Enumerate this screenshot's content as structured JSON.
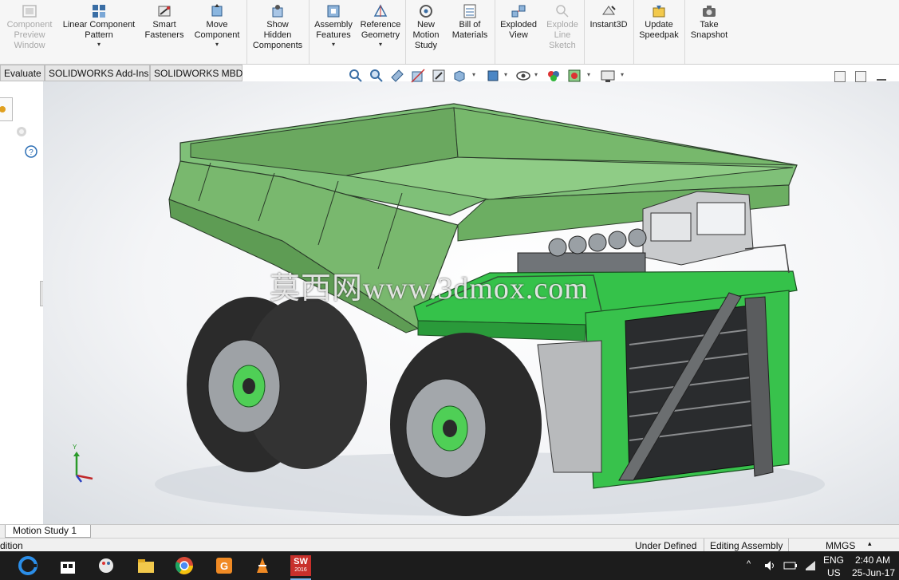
{
  "ribbon": {
    "buttons": [
      {
        "label": "Component\nPreview\nWindow",
        "icon": "component-preview-icon",
        "disabled": true,
        "dropdown": false
      },
      {
        "label": "Linear Component\nPattern",
        "icon": "linear-pattern-icon",
        "disabled": false,
        "dropdown": true
      },
      {
        "label": "Smart\nFasteners",
        "icon": "smart-fasteners-icon",
        "disabled": false,
        "dropdown": false
      },
      {
        "label": "Move\nComponent",
        "icon": "move-component-icon",
        "disabled": false,
        "dropdown": true
      },
      {
        "label": "Show\nHidden\nComponents",
        "icon": "show-hidden-icon",
        "disabled": false,
        "dropdown": false
      },
      {
        "label": "Assembly\nFeatures",
        "icon": "assembly-features-icon",
        "disabled": false,
        "dropdown": true
      },
      {
        "label": "Reference\nGeometry",
        "icon": "reference-geometry-icon",
        "disabled": false,
        "dropdown": true
      },
      {
        "label": "New\nMotion\nStudy",
        "icon": "motion-study-icon",
        "disabled": false,
        "dropdown": false
      },
      {
        "label": "Bill of\nMaterials",
        "icon": "bill-of-materials-icon",
        "disabled": false,
        "dropdown": false
      },
      {
        "label": "Exploded\nView",
        "icon": "exploded-view-icon",
        "disabled": false,
        "dropdown": false
      },
      {
        "label": "Explode\nLine\nSketch",
        "icon": "explode-line-sketch-icon",
        "disabled": true,
        "dropdown": false
      },
      {
        "label": "Instant3D",
        "icon": "instant3d-icon",
        "disabled": false,
        "dropdown": false
      },
      {
        "label": "Update\nSpeedpak",
        "icon": "speedpak-icon",
        "disabled": false,
        "dropdown": false
      },
      {
        "label": "Take\nSnapshot",
        "icon": "camera-icon",
        "disabled": false,
        "dropdown": false
      }
    ]
  },
  "tabs": [
    "Evaluate",
    "SOLIDWORKS Add-Ins",
    "SOLIDWORKS MBD"
  ],
  "viewport": {
    "watermark": "莫西网www.3dmox.com",
    "triad_label": "Y"
  },
  "bottom_tabs": [
    "Motion Study 1"
  ],
  "status": {
    "left": "dition",
    "under_defined": "Under Defined",
    "editing": "Editing Assembly",
    "units": "MMGS"
  },
  "taskbar": {
    "lang_top": "ENG",
    "lang_bottom": "US",
    "time": "2:40 AM",
    "date": "25-Jun-17",
    "solidworks_badge": "2016"
  },
  "colors": {
    "body_green": "#7ab86c",
    "accent_green": "#2fb53a",
    "tire": "#2b2b2b",
    "taskbar": "#1c1c1c"
  }
}
